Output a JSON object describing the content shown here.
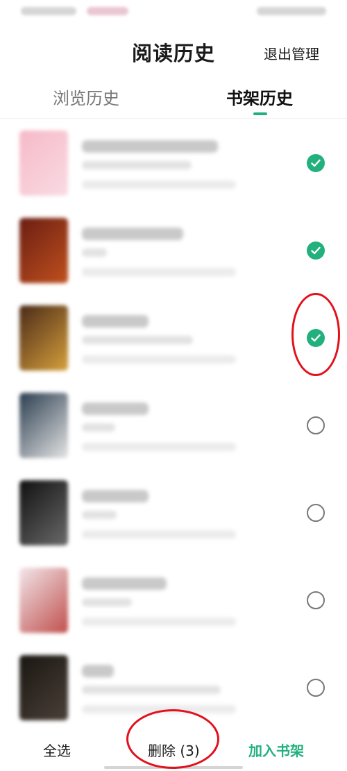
{
  "header": {
    "title": "阅读历史",
    "exit_manage": "退出管理"
  },
  "tabs": [
    {
      "label": "浏览历史",
      "active": false
    },
    {
      "label": "书架历史",
      "active": true
    }
  ],
  "books": [
    {
      "selected": true,
      "cover_colors": [
        "#f6b9c8",
        "#f9dbe3"
      ]
    },
    {
      "selected": true,
      "cover_colors": [
        "#6a1e12",
        "#c0501e"
      ]
    },
    {
      "selected": true,
      "cover_colors": [
        "#4a2a18",
        "#d6a03c"
      ]
    },
    {
      "selected": false,
      "cover_colors": [
        "#2c3e50",
        "#e4e4e4"
      ]
    },
    {
      "selected": false,
      "cover_colors": [
        "#101010",
        "#6a6a6a"
      ]
    },
    {
      "selected": false,
      "cover_colors": [
        "#f2e6ea",
        "#c0504d"
      ]
    },
    {
      "selected": false,
      "cover_colors": [
        "#1a1612",
        "#4a4038"
      ]
    }
  ],
  "bottom_bar": {
    "select_all": "全选",
    "delete": "删除 (3)",
    "add_to_shelf": "加入书架"
  },
  "colors": {
    "accent": "#22b07d",
    "annotation": "#e3101c"
  }
}
